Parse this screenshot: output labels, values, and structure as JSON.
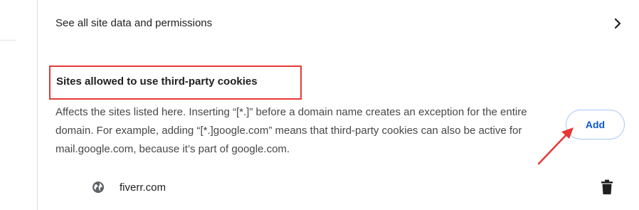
{
  "see_all_row": {
    "label": "See all site data and permissions",
    "icon": "chevron-right-icon"
  },
  "section": {
    "title": "Sites allowed to use third-party cookies",
    "description": "Affects the sites listed here. Inserting “[*.]” before a domain name creates an exception for the entire domain. For example, adding “[*.]google.com” means that third-party cookies can also be active for mail.google.com, because it’s part of google.com.",
    "add_button_label": "Add"
  },
  "sites": [
    {
      "name": "fiverr.com",
      "icon": "globe-icon",
      "action_icon": "trash-icon"
    }
  ],
  "annotations": {
    "highlight_color": "#e53935",
    "arrow_color": "#e53935"
  },
  "colors": {
    "accent": "#0b57d0",
    "button_border": "#a8c7fa"
  }
}
